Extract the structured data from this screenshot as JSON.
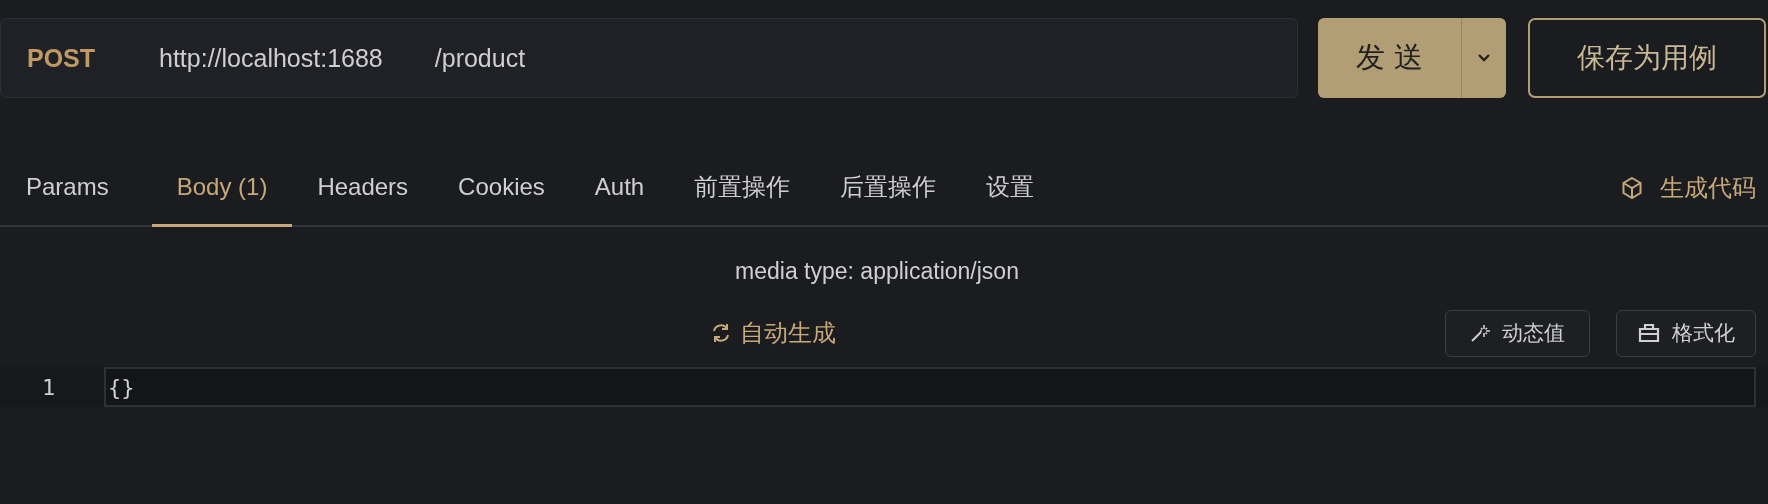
{
  "request": {
    "method": "POST",
    "host": "http://localhost:1688",
    "path": "/product"
  },
  "send_button": {
    "label": "发 送"
  },
  "save_button": {
    "label": "保存为用例"
  },
  "tabs": [
    {
      "label": "Params",
      "selected": false
    },
    {
      "label": "Body (1)",
      "selected": true
    },
    {
      "label": "Headers",
      "selected": false
    },
    {
      "label": "Cookies",
      "selected": false
    },
    {
      "label": "Auth",
      "selected": false
    },
    {
      "label": "前置操作",
      "selected": false
    },
    {
      "label": "后置操作",
      "selected": false
    },
    {
      "label": "设置",
      "selected": false
    }
  ],
  "generate_code": {
    "label": "生成代码"
  },
  "body": {
    "media_type": "media type: application/json",
    "auto_generate": "自动生成",
    "dynamic_value": "动态值",
    "format": "格式化"
  },
  "editor": {
    "lines": [
      {
        "number": "1",
        "text": "{}"
      }
    ]
  }
}
